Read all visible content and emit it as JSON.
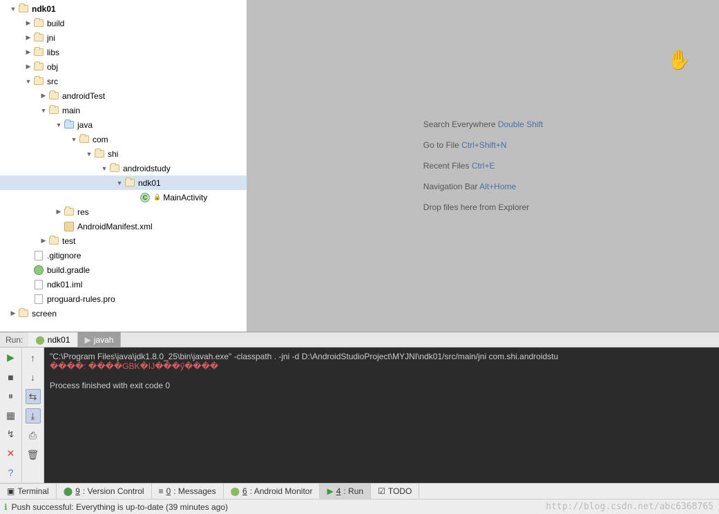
{
  "tree": {
    "root": "ndk01",
    "build": "build",
    "jni": "jni",
    "libs": "libs",
    "obj": "obj",
    "src": "src",
    "androidTest": "androidTest",
    "main": "main",
    "java": "java",
    "com": "com",
    "shi": "shi",
    "androidstudy": "androidstudy",
    "ndk01pkg": "ndk01",
    "mainActivity": "MainActivity",
    "res": "res",
    "manifest": "AndroidManifest.xml",
    "test": "test",
    "gitignore": ".gitignore",
    "buildGradle": "build.gradle",
    "iml": "ndk01.iml",
    "proguard": "proguard-rules.pro",
    "screen": "screen"
  },
  "hints": {
    "searchLabel": "Search Everywhere ",
    "searchKey": "Double Shift",
    "gotoLabel": "Go to File ",
    "gotoKey": "Ctrl+Shift+N",
    "recentLabel": "Recent Files ",
    "recentKey": "Ctrl+E",
    "navLabel": "Navigation Bar ",
    "navKey": "Alt+Home",
    "dropLabel": "Drop files here from Explorer"
  },
  "run": {
    "label": "Run:",
    "tab1": "ndk01",
    "tab2": "javah",
    "cmd": "\"C:\\Program Files\\java\\jdk1.8.0_25\\bin\\javah.exe\" -classpath . -jni -d D:\\AndroidStudioProject\\MYJNI\\ndk01/src/main/jni com.shi.androidstu",
    "err": "����: ����GBK�IJ���ӳ���ַ�",
    "exit": "Process finished with exit code 0"
  },
  "bottom": {
    "terminal": "Terminal",
    "vcPrefix": "9",
    "vc": ": Version Control",
    "msgPrefix": "0",
    "msg": ": Messages",
    "amPrefix": "6",
    "am": ": Android Monitor",
    "runPrefix": "4",
    "run": ": Run",
    "todo": "TODO"
  },
  "status": {
    "text": "Push successful: Everything is up-to-date (39 minutes ago)",
    "watermark": "http://blog.csdn.net/abc6368765"
  }
}
